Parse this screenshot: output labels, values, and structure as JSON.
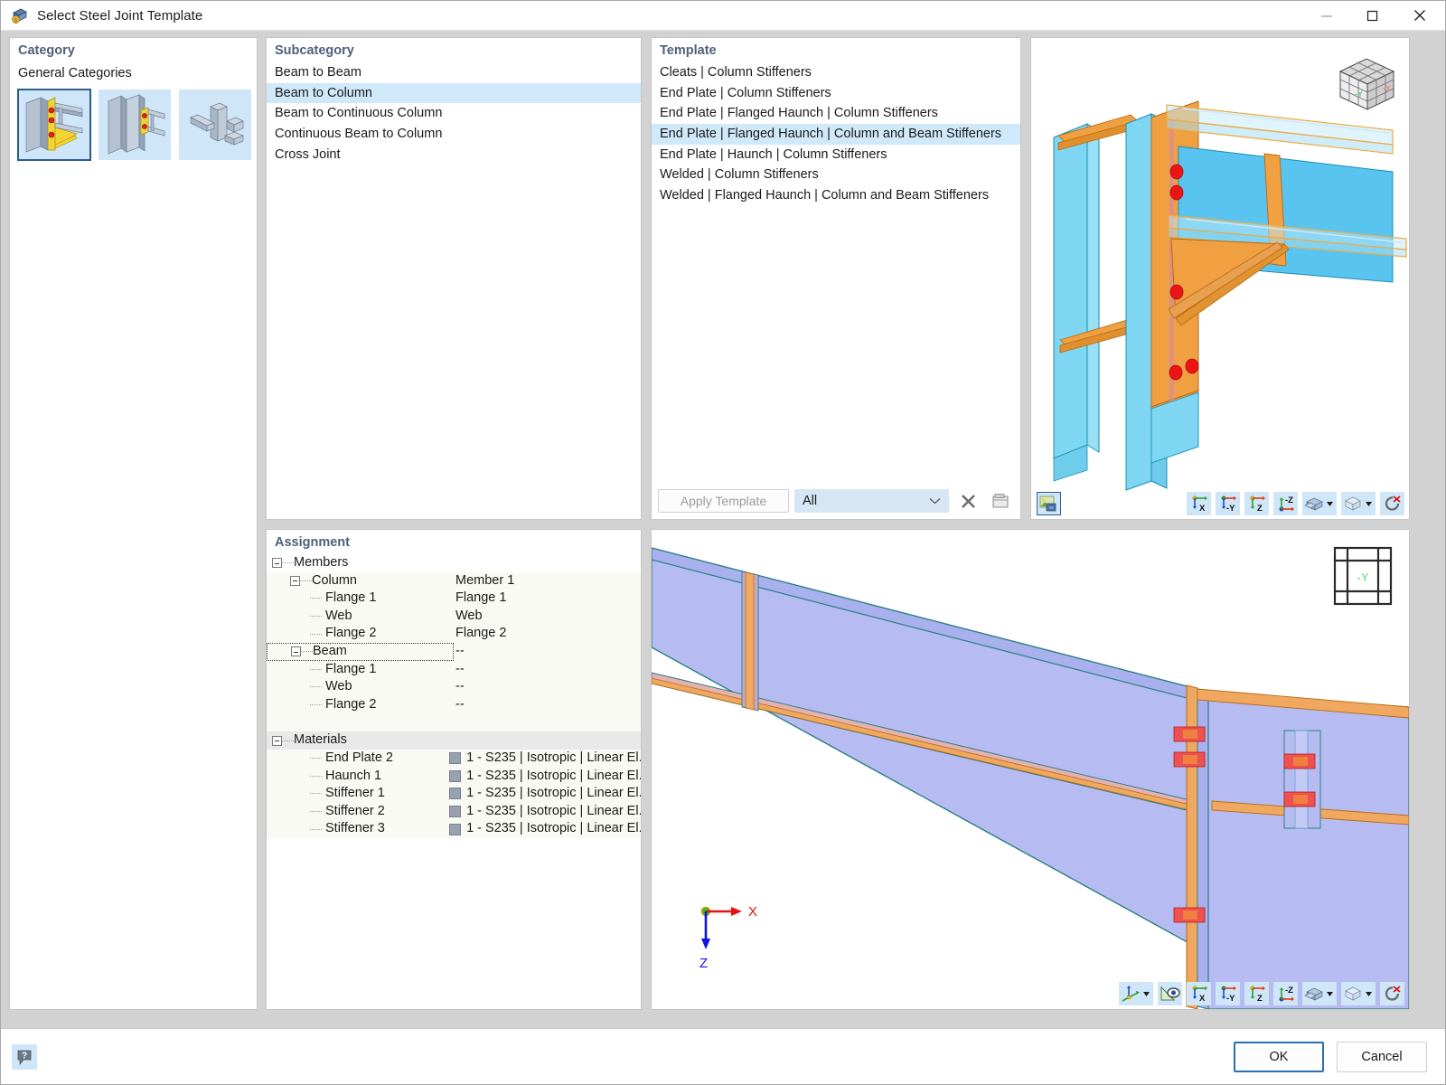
{
  "window": {
    "title": "Select Steel Joint Template",
    "icon": "steel-joint-icon",
    "minimize_label": "Minimize",
    "maximize_label": "Maximize",
    "close_label": "Close"
  },
  "category": {
    "title": "Category",
    "group_label": "General Categories",
    "thumbnails": [
      {
        "name": "beam-to-column-haunch-thumb",
        "selected": true
      },
      {
        "name": "beam-to-column-endplate-thumb",
        "selected": false
      },
      {
        "name": "cross-joint-tube-thumb",
        "selected": false
      }
    ]
  },
  "subcategory": {
    "title": "Subcategory",
    "items": [
      {
        "label": "Beam to Beam",
        "selected": false
      },
      {
        "label": "Beam to Column",
        "selected": true
      },
      {
        "label": "Beam to Continuous Column",
        "selected": false
      },
      {
        "label": "Continuous Beam to Column",
        "selected": false
      },
      {
        "label": "Cross Joint",
        "selected": false
      }
    ]
  },
  "template": {
    "title": "Template",
    "items": [
      {
        "label": "Cleats | Column Stiffeners",
        "selected": false
      },
      {
        "label": "End Plate | Column Stiffeners",
        "selected": false
      },
      {
        "label": "End Plate | Flanged Haunch | Column Stiffeners",
        "selected": false
      },
      {
        "label": "End Plate | Flanged Haunch | Column and Beam Stiffeners",
        "selected": true
      },
      {
        "label": "End Plate | Haunch | Column Stiffeners",
        "selected": false
      },
      {
        "label": "Welded | Column Stiffeners",
        "selected": false
      },
      {
        "label": "Welded | Flanged Haunch | Column and Beam Stiffeners",
        "selected": false
      }
    ],
    "apply_button": "Apply Template",
    "filter_value": "All",
    "delete_icon": "delete-x-icon",
    "import_icon": "import-template-icon"
  },
  "assignment": {
    "title": "Assignment",
    "groups": [
      {
        "name": "Members",
        "rows": [
          {
            "label": "Column",
            "value": "Member 1",
            "level": 1,
            "expandable": true
          },
          {
            "label": "Flange 1",
            "value": "Flange 1",
            "level": 2,
            "expandable": false
          },
          {
            "label": "Web",
            "value": "Web",
            "level": 2,
            "expandable": false
          },
          {
            "label": "Flange 2",
            "value": "Flange 2",
            "level": 2,
            "expandable": false
          },
          {
            "label": "Beam",
            "value": "--",
            "level": 1,
            "expandable": true,
            "focused": true
          },
          {
            "label": "Flange 1",
            "value": "--",
            "level": 2,
            "expandable": false
          },
          {
            "label": "Web",
            "value": "--",
            "level": 2,
            "expandable": false
          },
          {
            "label": "Flange 2",
            "value": "--",
            "level": 2,
            "expandable": false
          }
        ]
      },
      {
        "name": "Materials",
        "rows": [
          {
            "label": "End Plate 2",
            "value": "1 - S235 | Isotropic | Linear El...",
            "level": 2,
            "swatch": "#9aa1ae"
          },
          {
            "label": "Haunch 1",
            "value": "1 - S235 | Isotropic | Linear El...",
            "level": 2,
            "swatch": "#9aa1ae"
          },
          {
            "label": "Stiffener 1",
            "value": "1 - S235 | Isotropic | Linear El...",
            "level": 2,
            "swatch": "#9aa1ae"
          },
          {
            "label": "Stiffener 2",
            "value": "1 - S235 | Isotropic | Linear El...",
            "level": 2,
            "swatch": "#9aa1ae"
          },
          {
            "label": "Stiffener 3",
            "value": "1 - S235 | Isotropic | Linear El...",
            "level": 2,
            "swatch": "#9aa1ae"
          }
        ]
      }
    ]
  },
  "viewport_3d": {
    "name": "joint-3d-preview",
    "navcube_labels": {
      "left": "-Y",
      "right": "-X"
    },
    "toolbar": [
      {
        "name": "render-mode-button",
        "icon": "render-image-icon",
        "selected": true
      },
      {
        "name": "view-x-button",
        "icon": "axis-x-icon",
        "label": "X"
      },
      {
        "name": "view-negy-button",
        "icon": "axis-negy-icon",
        "label": "-Y"
      },
      {
        "name": "view-z-button",
        "icon": "axis-z-icon",
        "label": "Z"
      },
      {
        "name": "view-negz-button",
        "icon": "axis-negz-icon",
        "label": "-Z"
      },
      {
        "name": "display-style-button",
        "icon": "solid-blocks-icon",
        "dropdown": true
      },
      {
        "name": "wireframe-button",
        "icon": "wireframe-cube-icon",
        "dropdown": true
      },
      {
        "name": "reset-view-button",
        "icon": "reset-rotate-icon"
      }
    ]
  },
  "viewport_2d": {
    "name": "joint-section-preview",
    "axis_labels": {
      "x": "X",
      "z": "Z"
    },
    "navgrid_label": "-Y",
    "toolbar": [
      {
        "name": "coordinate-system-button",
        "icon": "axis-triad-icon",
        "dropdown": true
      },
      {
        "name": "visibility-button",
        "icon": "eye-visibility-icon"
      },
      {
        "name": "view-x-button",
        "icon": "axis-x-icon",
        "label": "X"
      },
      {
        "name": "view-negy-button",
        "icon": "axis-negy-icon",
        "label": "-Y"
      },
      {
        "name": "view-z-button",
        "icon": "axis-z-icon",
        "label": "Z"
      },
      {
        "name": "view-negz-button",
        "icon": "axis-negz-icon",
        "label": "-Z"
      },
      {
        "name": "display-style-button",
        "icon": "solid-blocks-icon",
        "dropdown": true
      },
      {
        "name": "wireframe-button",
        "icon": "wireframe-cube-icon",
        "dropdown": true
      },
      {
        "name": "reset-view-button",
        "icon": "reset-rotate-icon"
      }
    ]
  },
  "footer": {
    "help_icon": "help-question-icon",
    "ok_label": "OK",
    "cancel_label": "Cancel"
  },
  "colors": {
    "accent": "#2c5d8f",
    "selection": "#cfe8fa",
    "panel_title": "#4f6079",
    "toolbar_btn": "#cfe5f8",
    "steel_blue": "#58c4ef",
    "steel_orange": "#f0a040",
    "bolt_red": "#e81010"
  }
}
